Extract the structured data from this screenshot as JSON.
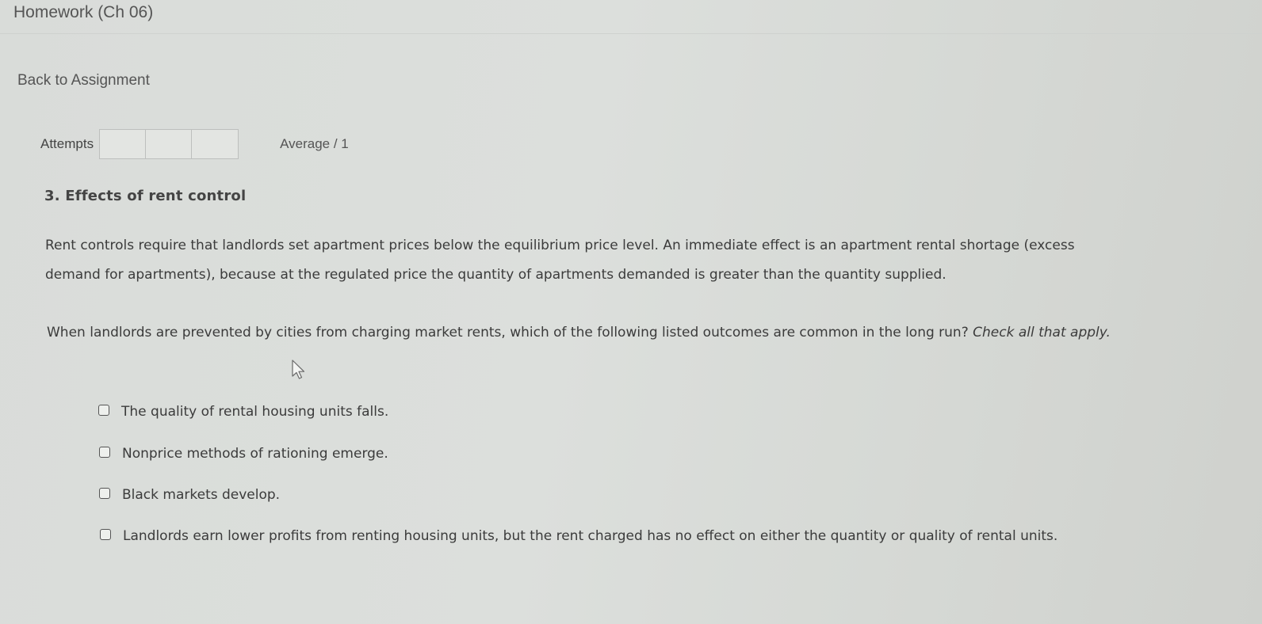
{
  "header": {
    "title": "Homework (Ch 06)"
  },
  "nav": {
    "back_label": "Back to Assignment"
  },
  "attempts": {
    "label": "Attempts",
    "boxes": [
      "",
      "",
      ""
    ],
    "average_label": "Average / 1"
  },
  "question": {
    "title": "3. Effects of rent control",
    "intro": "Rent controls require that landlords set apartment prices below the equilibrium price level. An immediate effect is an apartment rental shortage (excess demand for apartments), because at the regulated price the quantity of apartments demanded is greater than the quantity supplied.",
    "prompt": "When landlords are prevented by cities from charging market rents, which of the following listed outcomes are common in the long run?",
    "instruction": "Check all that apply.",
    "options": [
      {
        "label": "The quality of rental housing units falls.",
        "checked": false
      },
      {
        "label": "Nonprice methods of rationing emerge.",
        "checked": false
      },
      {
        "label": "Black markets develop.",
        "checked": false
      },
      {
        "label": "Landlords earn lower profits from renting housing units, but the rent charged has no effect on either the quantity or quality of rental units.",
        "checked": false
      }
    ]
  },
  "colors": {
    "background": "#dcdfdc",
    "text": "#3b3b3b",
    "muted": "#555555"
  },
  "icons": {
    "cursor": "mouse-pointer-icon",
    "checkbox": "checkbox-unchecked-icon"
  }
}
